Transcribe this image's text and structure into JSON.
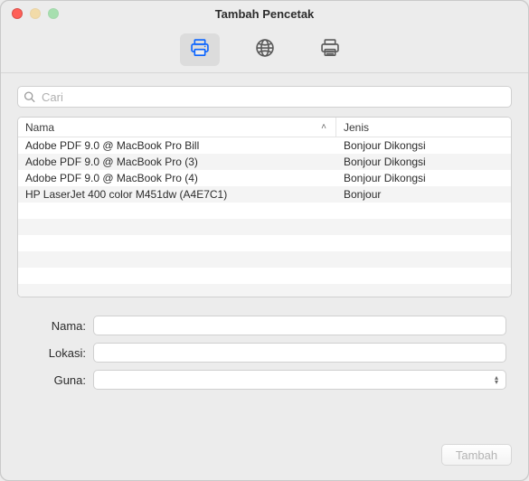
{
  "window": {
    "title": "Tambah Pencetak"
  },
  "toolbar": {
    "tabs": [
      {
        "id": "default",
        "active": true
      },
      {
        "id": "ip",
        "active": false
      },
      {
        "id": "windows",
        "active": false
      }
    ]
  },
  "search": {
    "placeholder": "Cari",
    "value": ""
  },
  "table": {
    "columns": {
      "name": "Nama",
      "kind": "Jenis"
    },
    "rows": [
      {
        "name": "Adobe PDF 9.0 @ MacBook Pro Bill",
        "kind": "Bonjour Dikongsi"
      },
      {
        "name": "Adobe PDF 9.0 @ MacBook Pro (3)",
        "kind": "Bonjour Dikongsi"
      },
      {
        "name": "Adobe PDF 9.0 @ MacBook Pro (4)",
        "kind": "Bonjour Dikongsi"
      },
      {
        "name": "HP LaserJet 400 color M451dw (A4E7C1)",
        "kind": "Bonjour"
      }
    ]
  },
  "form": {
    "name_label": "Nama:",
    "location_label": "Lokasi:",
    "use_label": "Guna:",
    "name_value": "",
    "location_value": "",
    "use_value": ""
  },
  "footer": {
    "add_label": "Tambah"
  }
}
